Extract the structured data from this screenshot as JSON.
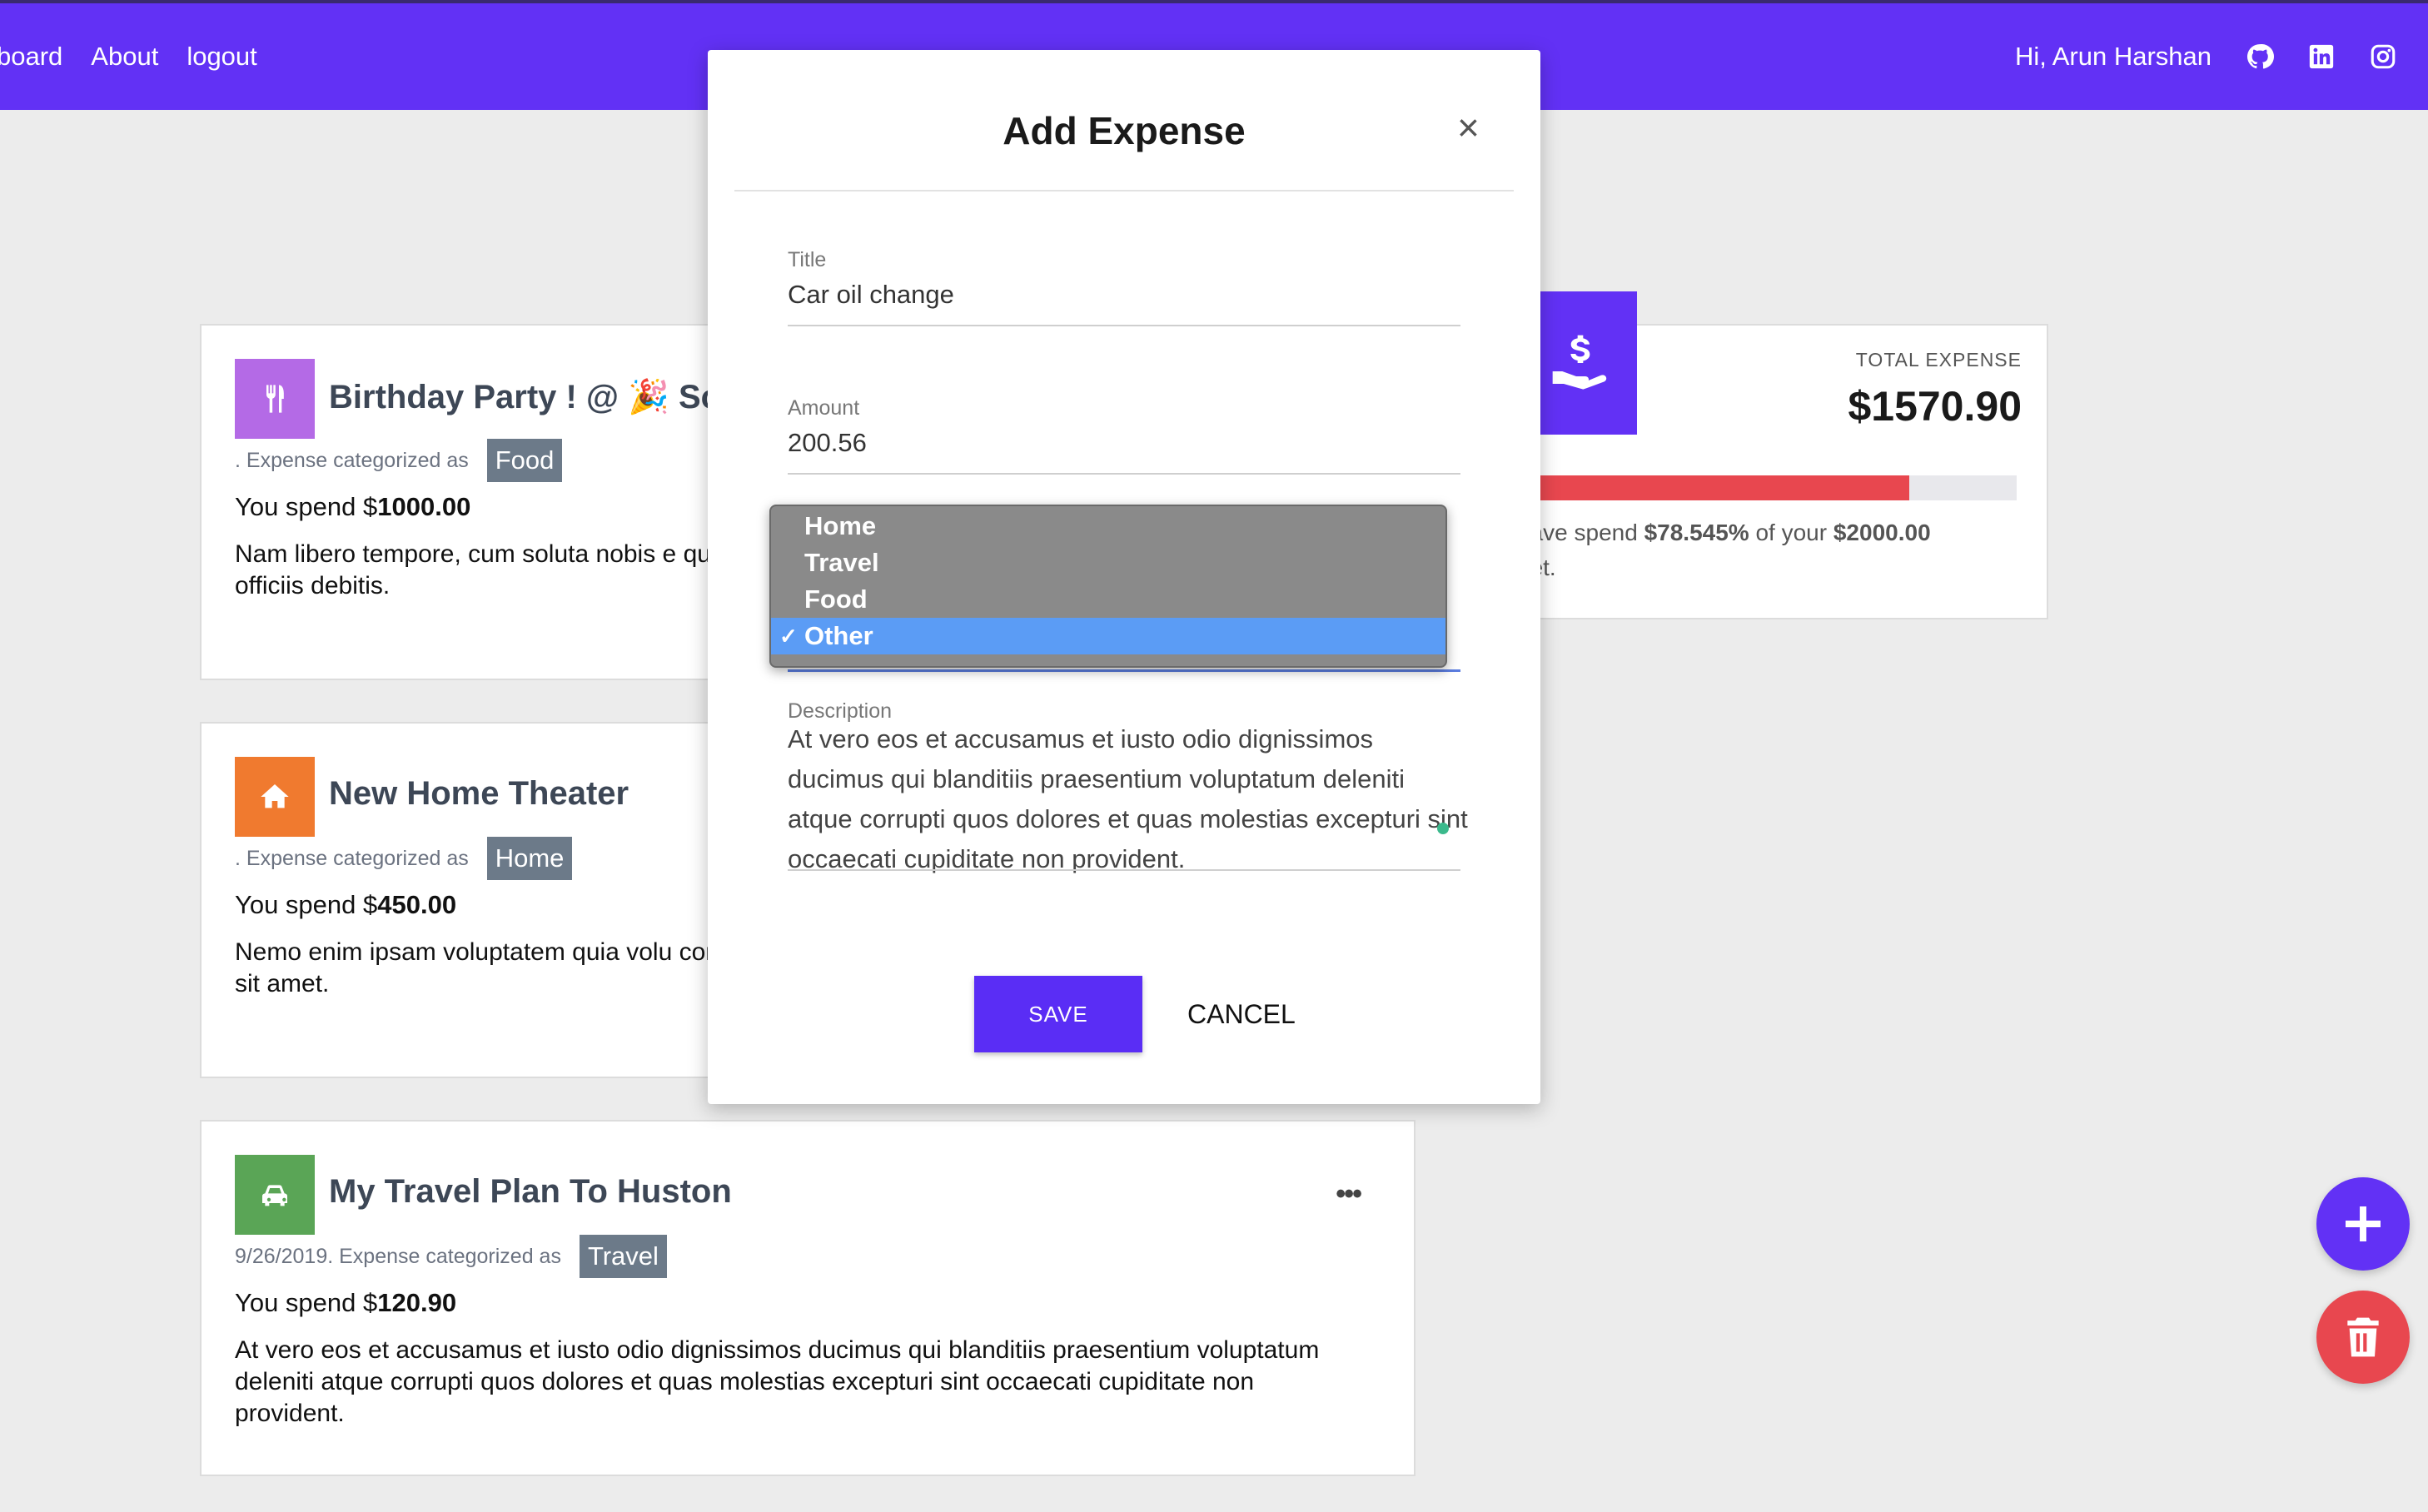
{
  "nav": {
    "links": [
      "board",
      "About",
      "logout"
    ],
    "greeting": "Hi, Arun Harshan",
    "icons": [
      "github-icon",
      "linkedin-icon",
      "instagram-icon"
    ],
    "color": "#6231f5"
  },
  "expenses": [
    {
      "title": "Birthday Party ! @ 🎉 Son",
      "icon": "utensils-icon",
      "icon_color": "#b46ae6",
      "meta": ". Expense categorized as",
      "category": "Food",
      "spend_prefix": "You spend $",
      "amount": "1000.00",
      "description": "Nam libero tempore, cum soluta nobis e quod maxime placeat facere possimus, repellendus et aut officiis debitis."
    },
    {
      "title": "New Home Theater",
      "icon": "home-icon",
      "icon_color": "#f07a2f",
      "meta": ". Expense categorized as",
      "category": "Home",
      "spend_prefix": "You spend $",
      "amount": "450.00",
      "description": "Nemo enim ipsam voluptatem quia volu consequuntur magni dolores eos qui rat dolorem ipsum quia sit amet."
    },
    {
      "title": "My Travel Plan To Huston",
      "icon": "car-icon",
      "icon_color": "#5aa556",
      "meta": "9/26/2019. Expense categorized as",
      "category": "Travel",
      "spend_prefix": "You spend $",
      "amount": "120.90",
      "description": "At vero eos et accusamus et iusto odio dignissimos ducimus qui blanditiis praesentium voluptatum deleniti atque corrupti quos dolores et quas molestias excepturi sint occaecati cupiditate non provident.",
      "more": "•••"
    }
  ],
  "summary": {
    "label": "TOTAL EXPENSE",
    "total": "$1570.90",
    "progress_fraction": 0.785,
    "note_prefix": "have spend",
    "note_percent": "$78.545%",
    "note_mid": "of your",
    "note_budget": "$2000.00",
    "note_suffix": "get."
  },
  "modal": {
    "title": "Add Expense",
    "close": "×",
    "title_label": "Title",
    "title_value": "Car oil change",
    "amount_label": "Amount",
    "amount_value": "200.56",
    "category_options": [
      "Home",
      "Travel",
      "Food",
      "Other"
    ],
    "category_selected": "Other",
    "check": "✓",
    "description_label": "Description",
    "description_value": "At vero eos et accusamus et iusto odio dignissimos ducimus qui blanditiis praesentium voluptatum deleniti atque corrupti quos dolores et quas molestias excepturi sint occaecati cupiditate non provident.",
    "save": "SAVE",
    "cancel": "CANCEL"
  },
  "fab": {
    "add_icon": "plus-icon",
    "delete_icon": "trash-icon"
  }
}
